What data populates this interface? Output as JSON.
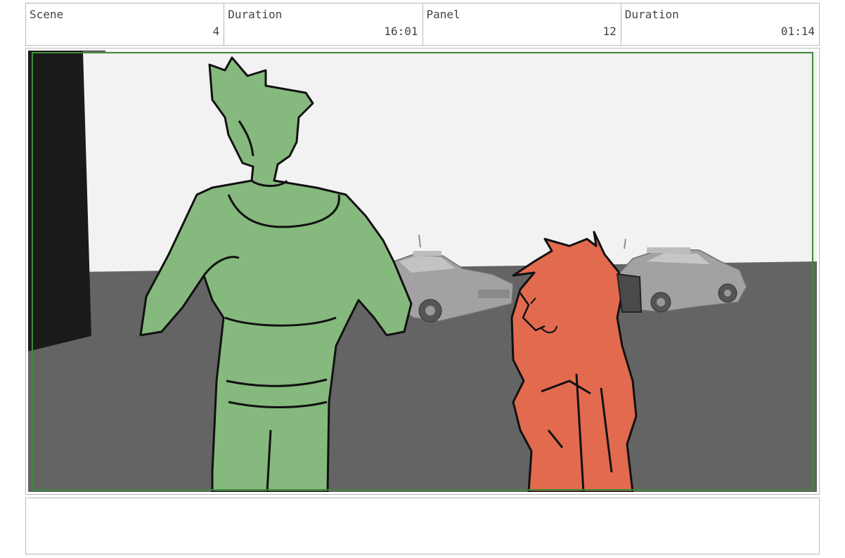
{
  "header": {
    "cells": [
      {
        "label": "Scene",
        "value": "4"
      },
      {
        "label": "Duration",
        "value": "16:01"
      },
      {
        "label": "Panel",
        "value": "12"
      },
      {
        "label": "Duration",
        "value": "01:14"
      }
    ]
  },
  "panel": {
    "colors": {
      "sky": "#ececec",
      "ground": "#646464",
      "wall": "#1a1a1a",
      "character_green": "#86b97d",
      "character_red": "#e26a4f",
      "car": "#9d9d9d",
      "frame": "#3f8a3a"
    }
  },
  "notes": {
    "text": ""
  }
}
